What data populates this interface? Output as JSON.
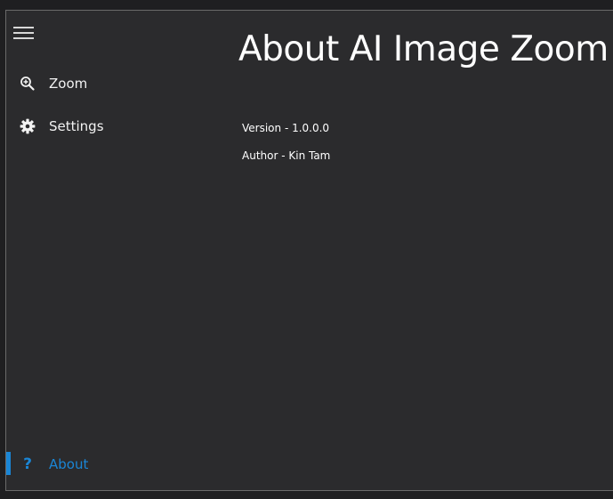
{
  "nav": {
    "menu_icon": "hamburger-menu-icon",
    "items": [
      {
        "label": "Zoom",
        "icon": "zoom-in-icon"
      },
      {
        "label": "Settings",
        "icon": "gear-icon"
      }
    ],
    "footer": {
      "label": "About",
      "icon": "question-mark-icon",
      "selected": true
    }
  },
  "page": {
    "title": "About AI Image Zoom",
    "version": "Version - 1.0.0.0",
    "author": "Author - Kin Tam"
  },
  "colors": {
    "background": "#2b2b2d",
    "accent": "#1a86d6",
    "text": "#ffffff",
    "border": "#6a6a6a"
  }
}
